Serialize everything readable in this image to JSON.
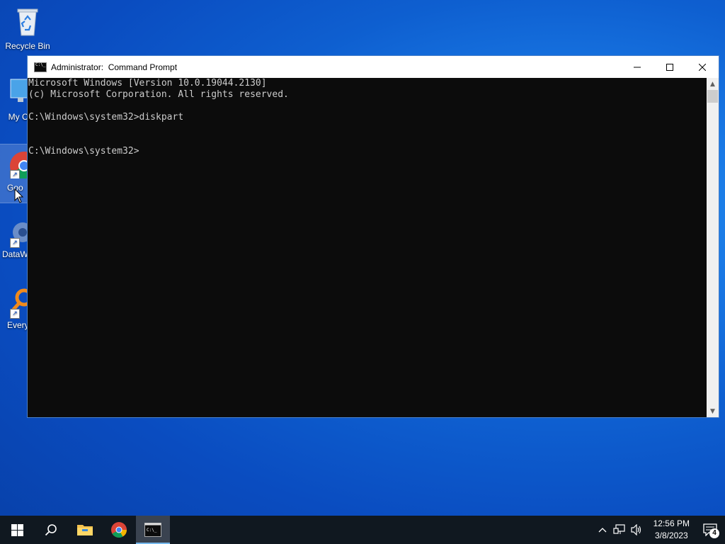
{
  "desktop": {
    "icons": [
      {
        "label": "Recycle Bin",
        "icon": "recycle-bin-icon"
      },
      {
        "label": "My Co",
        "icon": "computer-icon"
      },
      {
        "label": "Goo",
        "icon": "chrome-icon"
      },
      {
        "label": "DataW",
        "icon": "datawrapper-icon"
      },
      {
        "label": "Every",
        "icon": "everything-search-icon"
      }
    ]
  },
  "window": {
    "title": "Administrator:  Command Prompt",
    "minimize_glyph": "—",
    "maximize_glyph": "☐",
    "close_glyph": "✕",
    "console_lines": [
      "Microsoft Windows [Version 10.0.19044.2130]",
      "(c) Microsoft Corporation. All rights reserved.",
      "",
      "C:\\Windows\\system32>diskpart",
      "",
      "",
      "C:\\Windows\\system32>"
    ]
  },
  "taskbar": {
    "start_icon": "windows-start-icon",
    "search_icon": "search-icon",
    "pinned": [
      "file-explorer-icon",
      "chrome-icon",
      "command-prompt-icon"
    ],
    "active_app": "command-prompt-icon",
    "tray": {
      "time": "12:56 PM",
      "date": "3/8/2023",
      "notification_count": "4"
    }
  },
  "colors": {
    "console_bg": "#0c0c0c",
    "console_fg": "#cccccc",
    "taskbar_bg": "#101820",
    "accent": "#76b9ed"
  }
}
